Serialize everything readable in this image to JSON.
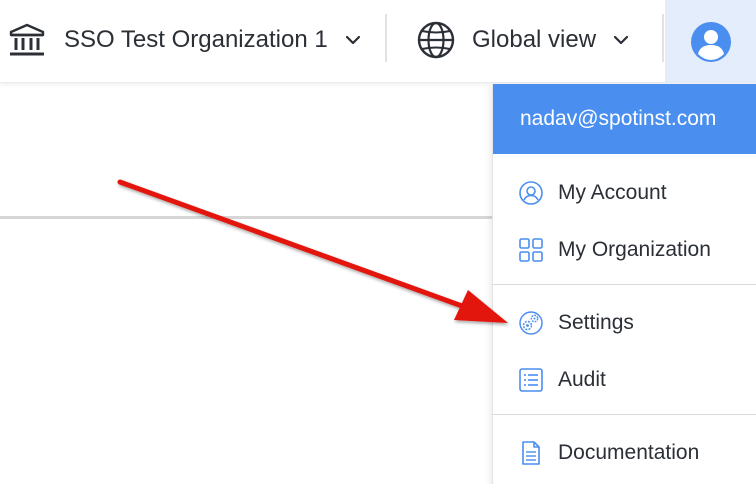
{
  "topbar": {
    "organization": {
      "name": "SSO Test Organization 1",
      "icon": "bank-icon"
    },
    "view": {
      "name": "Global view",
      "icon": "globe-icon"
    },
    "avatar": {
      "icon": "user-avatar-icon"
    }
  },
  "menu": {
    "user_email": "nadav@spotinst.com",
    "items": [
      {
        "label": "My Account",
        "icon": "account-icon"
      },
      {
        "label": "My Organization",
        "icon": "organization-grid-icon"
      },
      {
        "label": "Settings",
        "icon": "settings-gear-icon"
      },
      {
        "label": "Audit",
        "icon": "audit-list-icon"
      },
      {
        "label": "Documentation",
        "icon": "document-icon"
      }
    ]
  },
  "colors": {
    "accent": "#4a8ef0",
    "avatar_bg": "#e3edfb",
    "annotation_arrow": "#e3120b"
  }
}
